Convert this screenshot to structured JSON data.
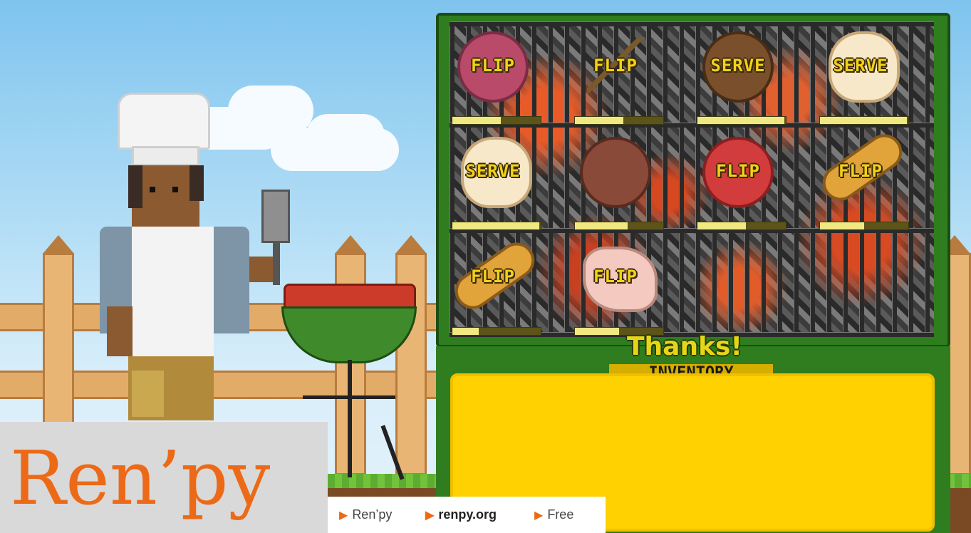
{
  "grill": {
    "cells": [
      {
        "food": "salami",
        "label": "FLIP",
        "progress": 0.55
      },
      {
        "food": "kebab",
        "label": "FLIP",
        "progress": 0.55
      },
      {
        "food": "burger",
        "label": "SERVE",
        "progress": 0.98
      },
      {
        "food": "chicken",
        "label": "SERVE",
        "progress": 0.98
      },
      {
        "food": "chicken",
        "label": "SERVE",
        "progress": 0.98
      },
      {
        "food": "burger-raw",
        "label": "",
        "progress": 0.6
      },
      {
        "food": "salami",
        "label": "FLIP",
        "progress": 0.55
      },
      {
        "food": "sausage",
        "label": "FLIP",
        "progress": 0.5
      },
      {
        "food": "sausage",
        "label": "FLIP",
        "progress": 0.3
      },
      {
        "food": "steak",
        "label": "FLIP",
        "progress": 0.5
      }
    ]
  },
  "status_text": "Thanks!",
  "inventory_label": "INVENTORY",
  "caption": {
    "title": "Ren’py",
    "items": [
      "Ren’py",
      "renpy.org",
      "Free"
    ]
  }
}
